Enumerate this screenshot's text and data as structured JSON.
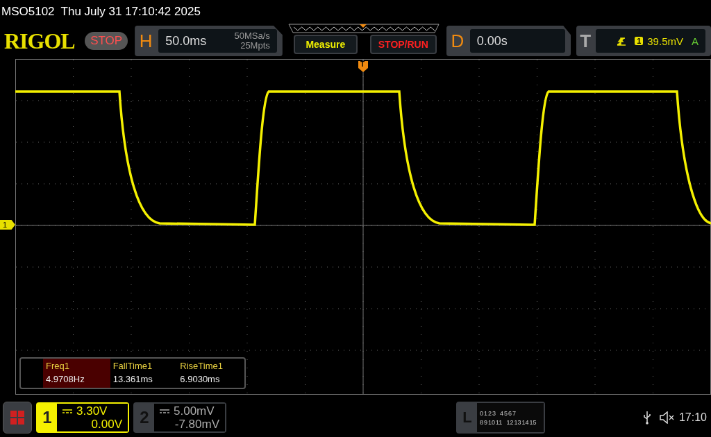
{
  "status_line": {
    "model": "MSO5102",
    "datetime": "Thu July 31 17:10:42 2025"
  },
  "toolbar": {
    "logo": "RIGOL",
    "run_state": "STOP",
    "horizontal": {
      "label": "H",
      "timebase": "50.0ms",
      "sample_rate": "50MSa/s",
      "memory_depth": "25Mpts"
    },
    "buttons": [
      {
        "label": "Measure",
        "kind": "measure"
      },
      {
        "label": "STOP/RUN",
        "kind": "run"
      }
    ],
    "delay": {
      "label": "D",
      "value": "0.00s"
    },
    "trigger": {
      "label": "T",
      "source": "1",
      "level": "39.5mV",
      "mode": "A"
    }
  },
  "display": {
    "trigger_marker": "T",
    "channel_marker": "1"
  },
  "measurements": [
    {
      "name": "Freq1",
      "value": "4.9708Hz",
      "selected": true
    },
    {
      "name": "FallTime1",
      "value": "13.361ms",
      "selected": false
    },
    {
      "name": "RiseTime1",
      "value": "6.9030ms",
      "selected": false
    }
  ],
  "channels": [
    {
      "number": "1",
      "scale": "3.30V",
      "offset": "0.00V",
      "active": true
    },
    {
      "number": "2",
      "scale": "5.00mV",
      "offset": "-7.80mV",
      "active": false
    }
  ],
  "logic": {
    "label": "L",
    "bits_low": [
      "0",
      "1",
      "2",
      "3",
      "4",
      "5",
      "6",
      "7"
    ],
    "bits_high": [
      "8",
      "9",
      "10",
      "11",
      "12",
      "13",
      "14",
      "15"
    ]
  },
  "system": {
    "clock": "17:10"
  }
}
